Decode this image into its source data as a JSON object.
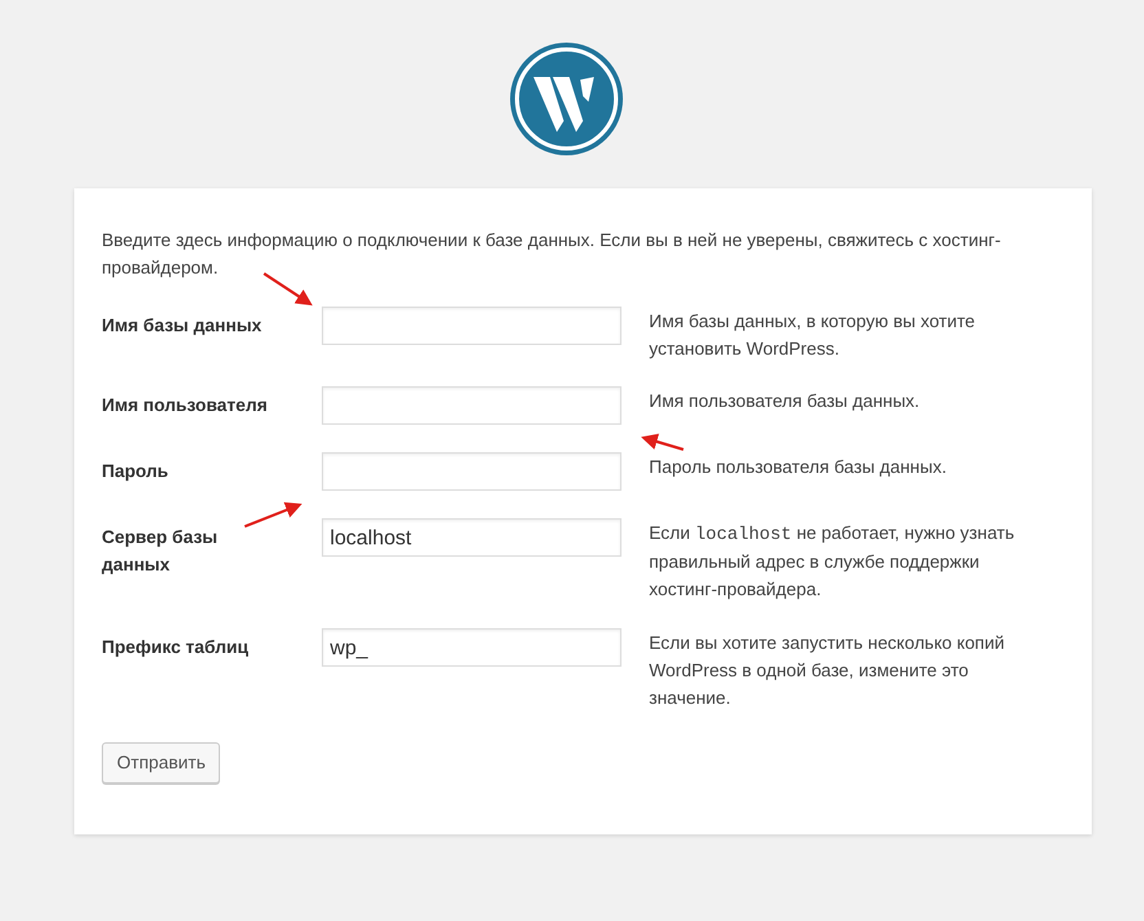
{
  "intro": "Введите здесь информацию о подключении к базе данных. Если вы в ней не уверены, свяжитесь с хостинг-провайдером.",
  "fields": [
    {
      "label": "Имя базы данных",
      "help": [
        {
          "kind": "text",
          "text": "Имя базы данных, в которую вы хотите установить WordPress."
        }
      ]
    },
    {
      "label": "Имя пользователя",
      "help": [
        {
          "kind": "text",
          "text": "Имя пользователя базы данных."
        }
      ]
    },
    {
      "label": "Пароль",
      "help": [
        {
          "kind": "text",
          "text": "Пароль пользователя базы данных."
        }
      ]
    },
    {
      "label": "Сервер базы данных",
      "value": "localhost",
      "help": [
        {
          "kind": "text",
          "text": "Если "
        },
        {
          "kind": "code",
          "text": "localhost"
        },
        {
          "kind": "text",
          "text": " не работает, нужно узнать правильный адрес в службе поддержки хостинг-провайдера."
        }
      ]
    },
    {
      "label": "Префикс таблиц",
      "value": "wp_",
      "help": [
        {
          "kind": "text",
          "text": "Если вы хотите запустить несколько копий WordPress в одной базе, измените это значение."
        }
      ]
    }
  ],
  "submit": "Отправить"
}
